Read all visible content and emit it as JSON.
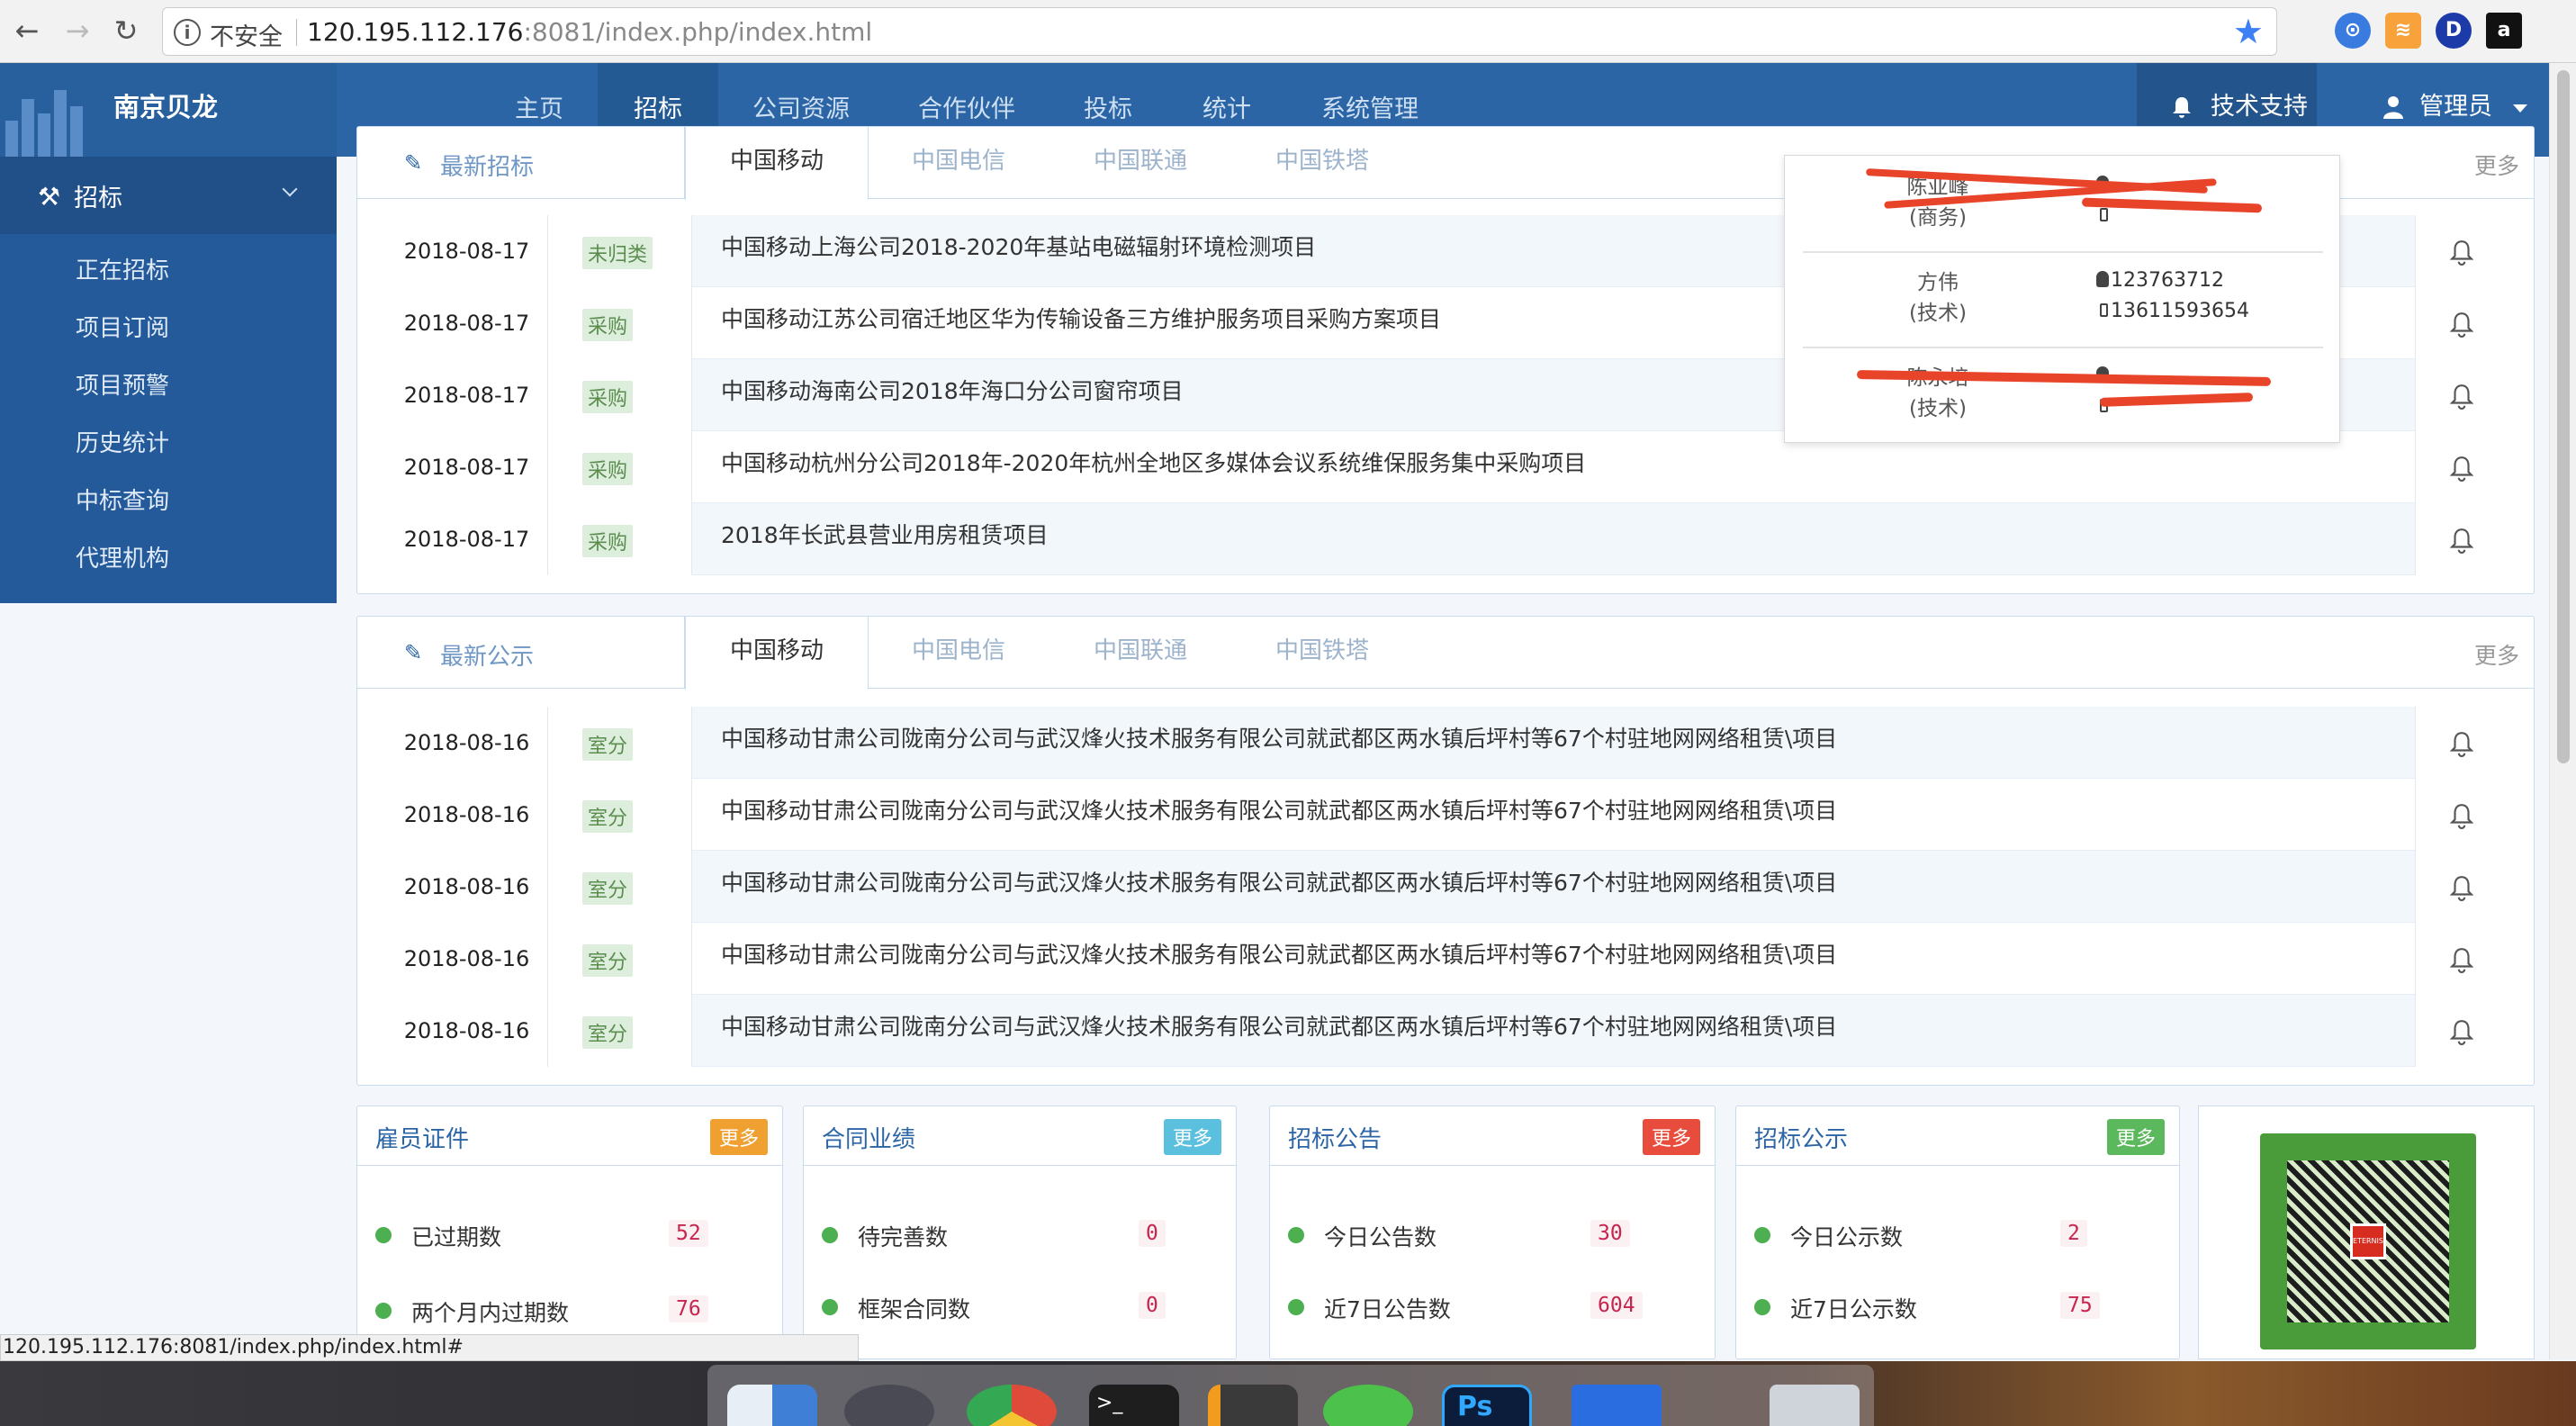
{
  "browser": {
    "insecure_label": "不安全",
    "url_host": "120.195.112.176",
    "url_rest": ":8081/index.php/index.html",
    "status_url": "120.195.112.176:8081/index.php/index.html#",
    "ext_icons": [
      "chrome-ext-icon",
      "rss-icon",
      "d-ext-icon",
      "amazon-icon"
    ]
  },
  "app": {
    "brand": "南京贝龙",
    "menu": [
      {
        "label": "主页",
        "active": false
      },
      {
        "label": "招标",
        "active": true
      },
      {
        "label": "公司资源",
        "active": false
      },
      {
        "label": "合作伙伴",
        "active": false
      },
      {
        "label": "投标",
        "active": false
      },
      {
        "label": "统计",
        "active": false
      },
      {
        "label": "系统管理",
        "active": false
      }
    ],
    "support": "技术支持",
    "admin": "管理员"
  },
  "sidebar": {
    "header": "招标",
    "items": [
      "正在招标",
      "项目订阅",
      "项目预警",
      "历史统计",
      "中标查询",
      "代理机构"
    ]
  },
  "panel1": {
    "title": "最新招标",
    "tabs": [
      "中国移动",
      "中国电信",
      "中国联通",
      "中国铁塔"
    ],
    "more": "更多",
    "rows": [
      {
        "date": "2018-08-17",
        "badge": "未归类",
        "title": "中国移动上海公司2018-2020年基站电磁辐射环境检测项目"
      },
      {
        "date": "2018-08-17",
        "badge": "采购",
        "title": "中国移动江苏公司宿迁地区华为传输设备三方维护服务项目采购方案项目"
      },
      {
        "date": "2018-08-17",
        "badge": "采购",
        "title": "中国移动海南公司2018年海口分公司窗帘项目"
      },
      {
        "date": "2018-08-17",
        "badge": "采购",
        "title": "中国移动杭州分公司2018年-2020年杭州全地区多媒体会议系统维保服务集中采购项目"
      },
      {
        "date": "2018-08-17",
        "badge": "采购",
        "title": "2018年长武县营业用房租赁项目"
      }
    ]
  },
  "panel2": {
    "title": "最新公示",
    "tabs": [
      "中国移动",
      "中国电信",
      "中国联通",
      "中国铁塔"
    ],
    "more": "更多",
    "rows": [
      {
        "date": "2018-08-16",
        "badge": "室分",
        "title": "中国移动甘肃公司陇南分公司与武汉烽火技术服务有限公司就武都区两水镇后坪村等67个村驻地网网络租赁\\项目"
      },
      {
        "date": "2018-08-16",
        "badge": "室分",
        "title": "中国移动甘肃公司陇南分公司与武汉烽火技术服务有限公司就武都区两水镇后坪村等67个村驻地网网络租赁\\项目"
      },
      {
        "date": "2018-08-16",
        "badge": "室分",
        "title": "中国移动甘肃公司陇南分公司与武汉烽火技术服务有限公司就武都区两水镇后坪村等67个村驻地网网络租赁\\项目"
      },
      {
        "date": "2018-08-16",
        "badge": "室分",
        "title": "中国移动甘肃公司陇南分公司与武汉烽火技术服务有限公司就武都区两水镇后坪村等67个村驻地网网络租赁\\项目"
      },
      {
        "date": "2018-08-16",
        "badge": "室分",
        "title": "中国移动甘肃公司陇南分公司与武汉烽火技术服务有限公司就武都区两水镇后坪村等67个村驻地网网络租赁\\项目"
      }
    ]
  },
  "popup": {
    "contacts": [
      {
        "name": "陈亚峰",
        "role": "(商务)",
        "qq": "",
        "phone": ""
      },
      {
        "name": "方伟",
        "role": "(技术)",
        "qq": "123763712",
        "phone": "13611593654"
      },
      {
        "name": "陈永培",
        "role": "(技术)",
        "qq": "",
        "phone": ""
      }
    ]
  },
  "cards": [
    {
      "title": "雇员证件",
      "more": "更多",
      "color": "#f0a030",
      "stats": [
        {
          "label": "已过期数",
          "value": "52"
        },
        {
          "label": "两个月内过期数",
          "value": "76"
        }
      ]
    },
    {
      "title": "合同业绩",
      "more": "更多",
      "color": "#5bc0de",
      "stats": [
        {
          "label": "待完善数",
          "value": "0"
        },
        {
          "label": "框架合同数",
          "value": "0"
        }
      ]
    },
    {
      "title": "招标公告",
      "more": "更多",
      "color": "#e74c3c",
      "stats": [
        {
          "label": "今日公告数",
          "value": "30"
        },
        {
          "label": "近7日公告数",
          "value": "604"
        }
      ]
    },
    {
      "title": "招标公示",
      "more": "更多",
      "color": "#5cb85c",
      "stats": [
        {
          "label": "今日公示数",
          "value": "2"
        },
        {
          "label": "近7日公示数",
          "value": "75"
        }
      ]
    }
  ],
  "qr_logo_text": "ETERNIS",
  "colors": {
    "nav": "#2b65a5",
    "sidebar": "#24599a",
    "accent": "#2b65a5"
  }
}
